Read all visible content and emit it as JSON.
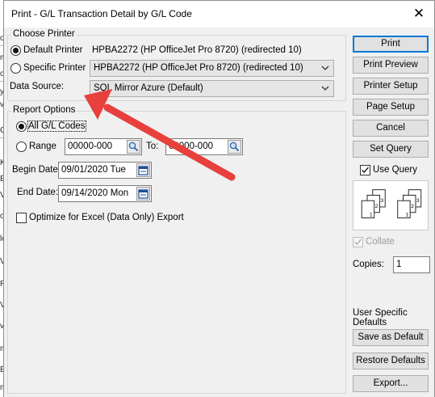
{
  "background_window": {
    "fragments": [
      "or",
      "m",
      "or",
      "ye",
      "ve",
      "Cr",
      "K",
      "Ex",
      "Ve",
      "on",
      "lop",
      "VE",
      "Re",
      "Vo",
      "ve",
      "m",
      "EC",
      "m"
    ]
  },
  "dialog": {
    "title": "Print - G/L Transaction Detail by G/L Code",
    "close_glyph": "✕"
  },
  "choose_printer": {
    "legend": "Choose Printer",
    "default_printer_label": "Default Printer",
    "default_printer_value": "HPBA2272 (HP OfficeJet Pro 8720) (redirected 10)",
    "default_printer_selected": true,
    "specific_printer_label": "Specific Printer",
    "specific_printer_value": "HPBA2272 (HP OfficeJet Pro 8720) (redirected 10)",
    "specific_printer_selected": false,
    "data_source_label": "Data Source:",
    "data_source_value": "SQL Mirror Azure (Default)"
  },
  "report_options": {
    "legend": "Report Options",
    "all_codes_label": "All G/L Codes",
    "all_codes_selected": true,
    "range_label": "Range",
    "range_selected": false,
    "range_from": "00000-000",
    "range_to_label": "To:",
    "range_to": "00000-000",
    "begin_date_label": "Begin Date:",
    "begin_date_value": "09/01/2020 Tue",
    "end_date_label": "End Date:",
    "end_date_value": "09/14/2020 Mon",
    "optimize_label": "Optimize for Excel (Data Only) Export",
    "optimize_checked": false
  },
  "side_panel": {
    "print": "Print",
    "print_preview": "Print Preview",
    "printer_setup": "Printer Setup",
    "page_setup": "Page Setup",
    "cancel": "Cancel",
    "set_query": "Set Query",
    "use_query_label": "Use Query",
    "use_query_checked": true,
    "collate_icon_pages": [
      "1",
      "2",
      "3",
      "1",
      "2",
      "3"
    ],
    "collate_label": "Collate",
    "collate_checked": true,
    "copies_label": "Copies:",
    "copies_value": "1",
    "user_defaults_label": "User Specific Defaults",
    "save_default": "Save as Default",
    "restore_defaults": "Restore Defaults",
    "export": "Export..."
  },
  "colors": {
    "annotation_arrow": "#e8403c",
    "dialog_bg": "#f0f0f0",
    "default_button_border": "#0078d7"
  },
  "icons": {
    "pick_icon": "magnifier-icon",
    "date_icon": "calendar-icon",
    "collate_icon": "collate-pages-icon",
    "dropdown_icon": "chevron-down-icon",
    "close_icon": "close-icon",
    "annotation": "red-arrow-annotation"
  }
}
